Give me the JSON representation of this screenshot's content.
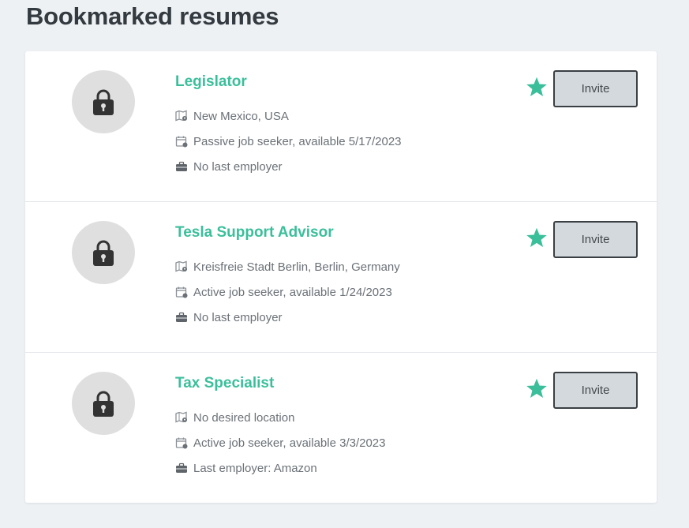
{
  "page": {
    "title": "Bookmarked resumes"
  },
  "resumes": [
    {
      "title": "Legislator",
      "location": "New Mexico, USA",
      "availability": "Passive job seeker, available 5/17/2023",
      "employer": "No last employer",
      "invite_label": "Invite"
    },
    {
      "title": "Tesla Support Advisor",
      "location": "Kreisfreie Stadt Berlin, Berlin, Germany",
      "availability": "Active job seeker, available 1/24/2023",
      "employer": "No last employer",
      "invite_label": "Invite"
    },
    {
      "title": "Tax Specialist",
      "location": "No desired location",
      "availability": "Active job seeker, available 3/3/2023",
      "employer": "Last employer: Amazon",
      "invite_label": "Invite"
    }
  ],
  "icons": {
    "avatar": "lock-icon",
    "location": "map-pin-icon",
    "availability": "calendar-icon",
    "employer": "briefcase-icon",
    "bookmark": "star-icon"
  },
  "colors": {
    "accent": "#3bbf9b",
    "background": "#eef1f4",
    "button_bg": "#d4d9de",
    "text_muted": "#6b7177"
  }
}
